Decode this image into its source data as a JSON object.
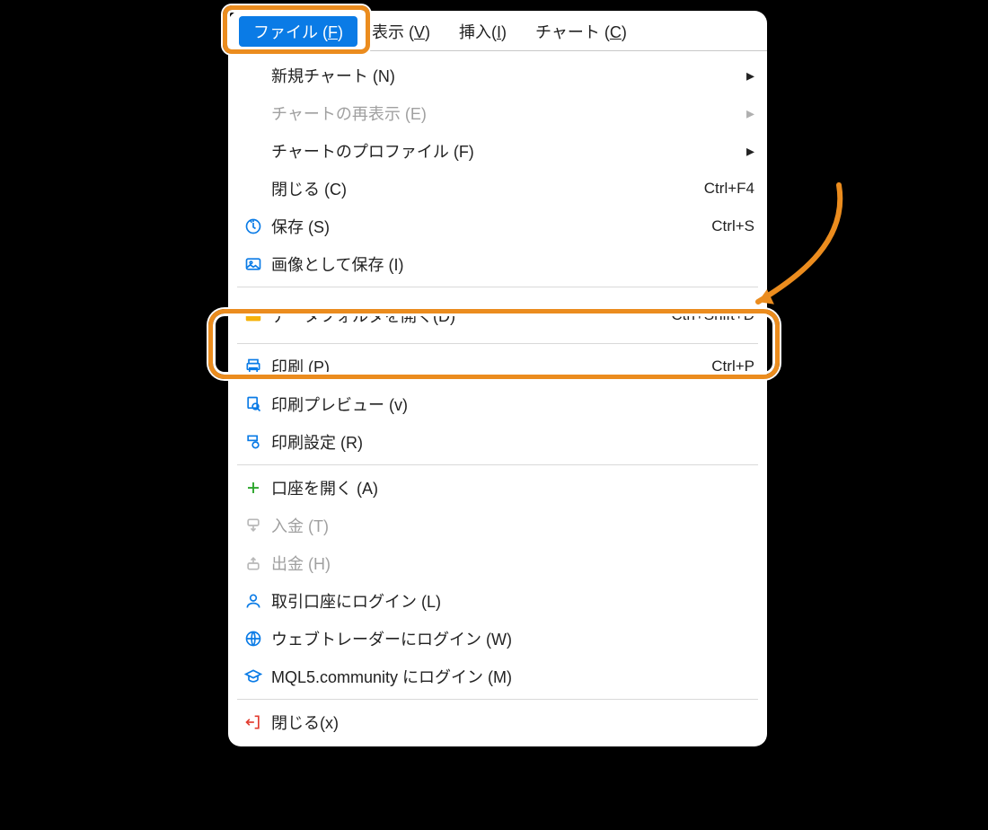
{
  "menubar": {
    "file": {
      "text": "ファイル (",
      "accel": "F",
      "close": ")"
    },
    "view": {
      "text": "表示 (",
      "accel": "V",
      "close": ")"
    },
    "insert": {
      "text": "挿入(",
      "accel": "I",
      "close": ")"
    },
    "chart": {
      "text": "チャート (",
      "accel": "C",
      "close": ")"
    }
  },
  "menu": {
    "newChart": {
      "label": "新規チャート (N)"
    },
    "reshowChart": {
      "label": "チャートの再表示 (E)"
    },
    "chartProfile": {
      "label": "チャートのプロファイル (F)"
    },
    "close": {
      "label": "閉じる (C)",
      "shortcut": "Ctrl+F4"
    },
    "save": {
      "label": "保存 (S)",
      "shortcut": "Ctrl+S"
    },
    "saveImage": {
      "label": "画像として保存 (I)"
    },
    "openData": {
      "label": "データフォルダを開く(D)",
      "shortcut": "Ctrl+Shift+D"
    },
    "print": {
      "label": "印刷 (P)",
      "shortcut": "Ctrl+P"
    },
    "printPreview": {
      "label": "印刷プレビュー (v)"
    },
    "printSetup": {
      "label": "印刷設定 (R)"
    },
    "openAccount": {
      "label": "口座を開く (A)"
    },
    "deposit": {
      "label": "入金 (T)"
    },
    "withdraw": {
      "label": "出金 (H)"
    },
    "loginAccount": {
      "label": "取引口座にログイン (L)"
    },
    "loginWeb": {
      "label": "ウェブトレーダーにログイン (W)"
    },
    "loginMql5": {
      "label": "MQL5.community にログイン (M)"
    },
    "closeApp": {
      "label": "閉じる(x)"
    }
  }
}
